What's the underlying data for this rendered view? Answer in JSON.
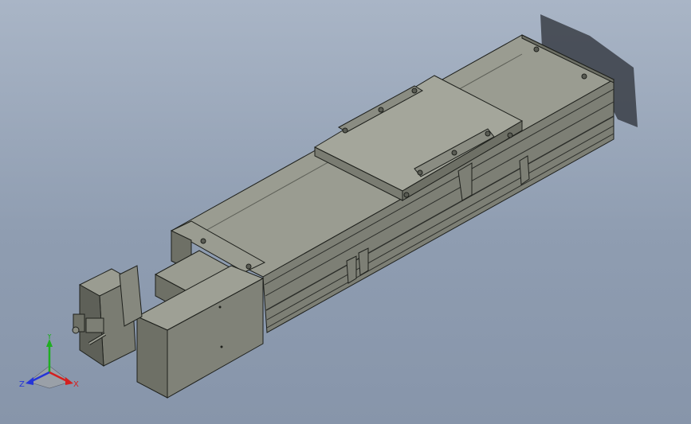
{
  "viewport": {
    "background_top": "#a9b5c6",
    "background_bottom": "#8795aa"
  },
  "model": {
    "part_color": "#8b8d82",
    "part_top_color": "#9a9c91",
    "part_dark_color": "#6e7066",
    "edge_color": "#1e201c",
    "shadow_color": "#3a3e46"
  },
  "triad": {
    "x_label": "X",
    "y_label": "Y",
    "z_label": "Z",
    "x_color": "#d42020",
    "y_color": "#1fae22",
    "z_color": "#2535d8"
  }
}
